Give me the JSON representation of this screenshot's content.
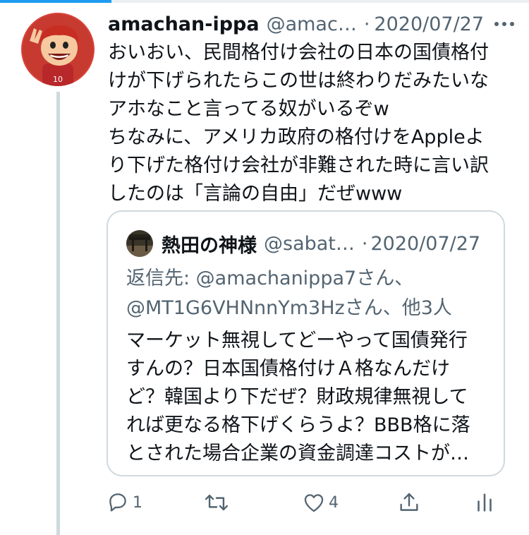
{
  "accent_color": "#1d9bf0",
  "progress_fraction": 0.21,
  "tweet": {
    "display_name": "amachan-ippa",
    "handle": "@amac…",
    "separator": "·",
    "date": "2020/07/27",
    "avatar_icon": "cartoon-avatar",
    "more_icon": "more-dots-icon",
    "text_lines": [
      "おいおい、民間格付け会社の日本の国債格付",
      "けが下げられたらこの世は終わりだみたいな",
      "アホなこと言ってる奴がいるぞw",
      "ちなみに、アメリカ政府の格付けをAppleよ",
      "り下げた格付け会社が非難された時に言い訳",
      "したのは「言論の自由」だぜwww"
    ]
  },
  "quote": {
    "display_name": "熱田の神様",
    "handle": "@sabat…",
    "separator": "·",
    "date": "2020/07/27",
    "reply_lines": [
      "返信先: @amachanippa7さん、",
      "@MT1G6VHNnnYm3Hzさん、他3人"
    ],
    "text_lines": [
      "マーケット無視してどーやって国債発行",
      "すんの？日本国債格付けＡ格なんだけ",
      "ど？韓国より下だぜ？財政規律無視して",
      "れば更なる格下げくらうよ？BBB格に落",
      "とされた場合企業の資金調達コストが…"
    ]
  },
  "actions": {
    "reply_count": "1",
    "retweet_count": "",
    "like_count": "4"
  }
}
